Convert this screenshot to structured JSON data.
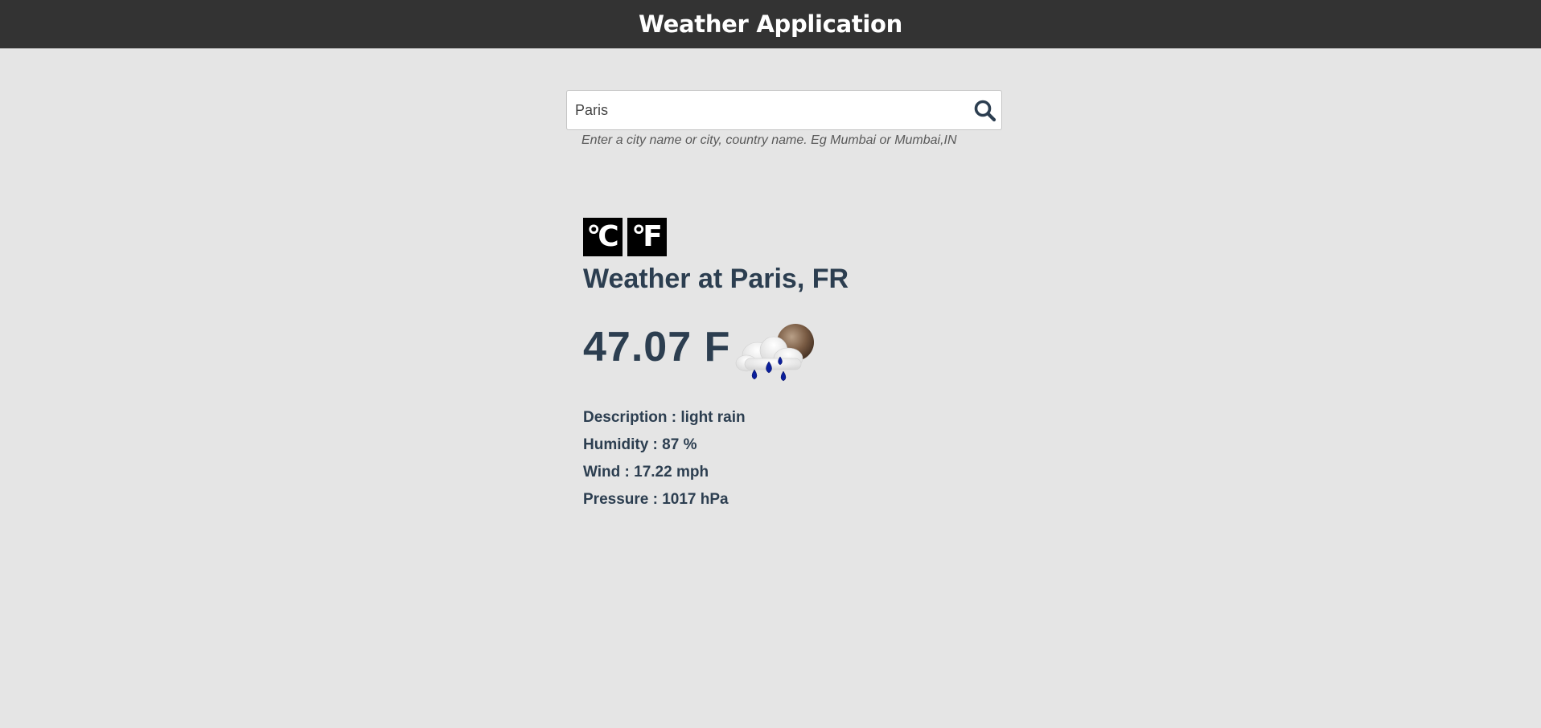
{
  "header": {
    "title": "Weather Application"
  },
  "search": {
    "value": "Paris",
    "help_text": "Enter a city name or city, country name. Eg Mumbai or Mumbai,IN",
    "icon": "search-icon"
  },
  "units": {
    "celsius_label": "°C",
    "fahrenheit_label": "°F"
  },
  "weather": {
    "location_title": "Weather at Paris, FR",
    "temperature": "47.07 F",
    "icon": "light-rain-icon",
    "details": [
      {
        "label": "Description",
        "value": "light rain",
        "text": "Description : light rain"
      },
      {
        "label": "Humidity",
        "value": "87 %",
        "text": "Humidity : 87 %"
      },
      {
        "label": "Wind",
        "value": "17.22 mph",
        "text": "Wind : 17.22 mph"
      },
      {
        "label": "Pressure",
        "value": "1017 hPa",
        "text": "Pressure : 1017 hPa"
      }
    ]
  },
  "colors": {
    "navbar_bg": "#333333",
    "page_bg": "#e5e5e5",
    "text_primary": "#2c3e50",
    "unit_button_bg": "#000000"
  }
}
